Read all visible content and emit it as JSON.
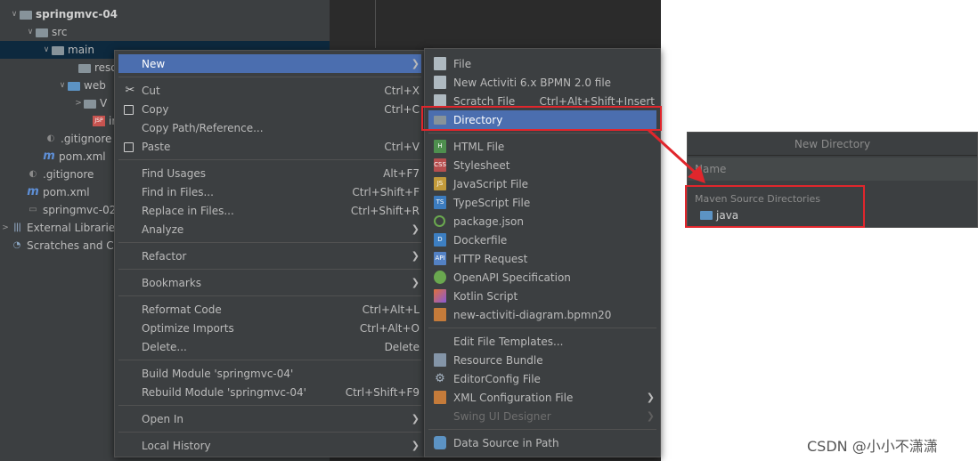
{
  "project_tree": {
    "items": [
      {
        "label": "springmvc-04",
        "arrow": "∨",
        "icon": "folder-icon"
      },
      {
        "label": "src",
        "arrow": "∨",
        "icon": "folder-icon"
      },
      {
        "label": "main",
        "arrow": "∨",
        "icon": "folder-icon"
      },
      {
        "label": "reso",
        "arrow": "",
        "icon": "folder-icon"
      },
      {
        "label": "web",
        "arrow": "∨",
        "icon": "folder-icon"
      },
      {
        "label": "V",
        "arrow": ">",
        "icon": "folder-icon"
      },
      {
        "label": "ir",
        "arrow": "",
        "icon": "jsp-icon"
      },
      {
        "label": ".gitignore",
        "arrow": "",
        "icon": "gitignore-icon"
      },
      {
        "label": "pom.xml",
        "arrow": "",
        "icon": "maven-icon"
      },
      {
        "label": ".gitignore",
        "arrow": "",
        "icon": "gitignore-icon"
      },
      {
        "label": "pom.xml",
        "arrow": "",
        "icon": "maven-icon"
      },
      {
        "label": "springmvc-02",
        "arrow": "",
        "icon": "file-icon"
      },
      {
        "label": "External Libraries",
        "arrow": ">",
        "icon": "libraries-icon"
      },
      {
        "label": "Scratches and Co",
        "arrow": "",
        "icon": "scratches-icon"
      }
    ]
  },
  "context_menu": {
    "new": "New",
    "cut": "Cut",
    "cut_sc": "Ctrl+X",
    "copy": "Copy",
    "copy_sc": "Ctrl+C",
    "copy_path": "Copy Path/Reference...",
    "paste": "Paste",
    "paste_sc": "Ctrl+V",
    "find_usages": "Find Usages",
    "find_usages_sc": "Alt+F7",
    "find_in_files": "Find in Files...",
    "find_in_files_sc": "Ctrl+Shift+F",
    "replace_in_files": "Replace in Files...",
    "replace_in_files_sc": "Ctrl+Shift+R",
    "analyze": "Analyze",
    "refactor": "Refactor",
    "bookmarks": "Bookmarks",
    "reformat": "Reformat Code",
    "reformat_sc": "Ctrl+Alt+L",
    "optimize": "Optimize Imports",
    "optimize_sc": "Ctrl+Alt+O",
    "delete": "Delete...",
    "delete_sc": "Delete",
    "build_module": "Build Module 'springmvc-04'",
    "rebuild_module": "Rebuild Module 'springmvc-04'",
    "rebuild_module_sc": "Ctrl+Shift+F9",
    "open_in": "Open In",
    "local_history": "Local History"
  },
  "new_submenu": {
    "file": "File",
    "activiti": "New Activiti 6.x BPMN 2.0 file",
    "scratch": "Scratch File",
    "scratch_sc": "Ctrl+Alt+Shift+Insert",
    "directory": "Directory",
    "html": "HTML File",
    "stylesheet": "Stylesheet",
    "javascript": "JavaScript File",
    "typescript": "TypeScript File",
    "package_json": "package.json",
    "dockerfile": "Dockerfile",
    "http": "HTTP Request",
    "openapi": "OpenAPI Specification",
    "kotlin": "Kotlin Script",
    "activiti_diagram": "new-activiti-diagram.bpmn20",
    "edit_templates": "Edit File Templates...",
    "resource_bundle": "Resource Bundle",
    "editorconfig": "EditorConfig File",
    "xml_config": "XML Configuration File",
    "swing": "Swing UI Designer",
    "data_source": "Data Source in Path"
  },
  "new_directory_dialog": {
    "title": "New Directory",
    "name_placeholder": "Name",
    "section": "Maven Source Directories",
    "suggestion": "java"
  },
  "watermark": "CSDN @小小不潇潇",
  "colors": {
    "highlight": "#4b6eaf",
    "menu_bg": "#3c3f41",
    "annotation_red": "#e0262c"
  }
}
